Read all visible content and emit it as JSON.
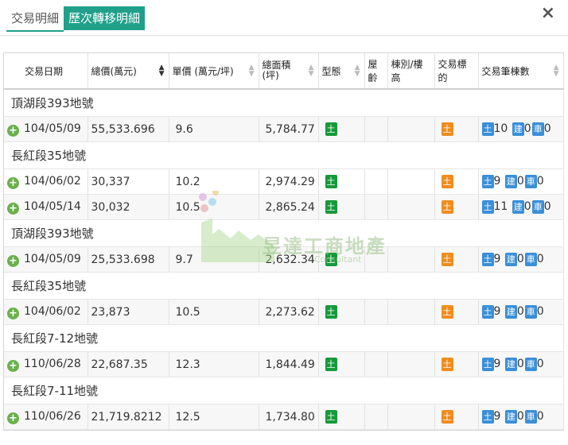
{
  "tabs": [
    {
      "label": "交易明細"
    },
    {
      "label": "歷次轉移明細"
    }
  ],
  "close_icon": "×",
  "columns": [
    "交易日期",
    "總價(萬元)",
    "單價 (萬元/坪)",
    "總面積\n(坪)",
    "型態",
    "屋齡",
    "棟別/樓高",
    "交易標的",
    "交易筆棟數"
  ],
  "sorted_column": "總價(萬元)",
  "groups": [
    {
      "title": "頂湖段393地號",
      "rows": [
        {
          "date": "104/05/09",
          "total": "55,533.696",
          "unit": "9.6",
          "area": "5,784.77",
          "type_badge": "土",
          "target_badge": "土",
          "land": "土",
          "land_n": "10",
          "bldg": "建",
          "bldg_n": "0",
          "car": "車",
          "car_n": "0"
        }
      ]
    },
    {
      "title": "長紅段35地號",
      "rows": [
        {
          "date": "104/06/02",
          "total": "30,337",
          "unit": "10.2",
          "area": "2,974.29",
          "type_badge": "土",
          "target_badge": "土",
          "land": "土",
          "land_n": "9",
          "bldg": "建",
          "bldg_n": "0",
          "car": "車",
          "car_n": "0"
        },
        {
          "date": "104/05/14",
          "total": "30,032",
          "unit": "10.5",
          "area": "2,865.24",
          "type_badge": "土",
          "target_badge": "土",
          "land": "土",
          "land_n": "11",
          "bldg": "建",
          "bldg_n": "0",
          "car": "車",
          "car_n": "0"
        }
      ]
    },
    {
      "title": "頂湖段393地號",
      "rows": [
        {
          "date": "104/05/09",
          "total": "25,533.698",
          "unit": "9.7",
          "area": "2,632.34",
          "type_badge": "土",
          "target_badge": "土",
          "land": "土",
          "land_n": "9",
          "bldg": "建",
          "bldg_n": "0",
          "car": "車",
          "car_n": "0"
        }
      ]
    },
    {
      "title": "長紅段35地號",
      "rows": [
        {
          "date": "104/06/02",
          "total": "23,873",
          "unit": "10.5",
          "area": "2,273.62",
          "type_badge": "土",
          "target_badge": "土",
          "land": "土",
          "land_n": "9",
          "bldg": "建",
          "bldg_n": "0",
          "car": "車",
          "car_n": "0"
        }
      ]
    },
    {
      "title": "長紅段7-12地號",
      "rows": [
        {
          "date": "110/06/28",
          "total": "22,687.35",
          "unit": "12.3",
          "area": "1,844.49",
          "type_badge": "土",
          "target_badge": "土",
          "land": "土",
          "land_n": "9",
          "bldg": "建",
          "bldg_n": "0",
          "car": "車",
          "car_n": "0"
        }
      ]
    },
    {
      "title": "長紅段7-11地號",
      "rows": [
        {
          "date": "110/06/26",
          "total": "21,719.8212",
          "unit": "12.5",
          "area": "1,734.80",
          "type_badge": "土",
          "target_badge": "土",
          "land": "土",
          "land_n": "9",
          "bldg": "建",
          "bldg_n": "0",
          "car": "車",
          "car_n": "0"
        }
      ]
    }
  ],
  "watermark": {
    "name": "昱達工商地產",
    "sub": "Consultant"
  },
  "colors": {
    "tab_active": "#20a08a",
    "badge_green": "#159a3a",
    "badge_orange": "#f08c1e",
    "badge_blue": "#3a8fd8"
  }
}
